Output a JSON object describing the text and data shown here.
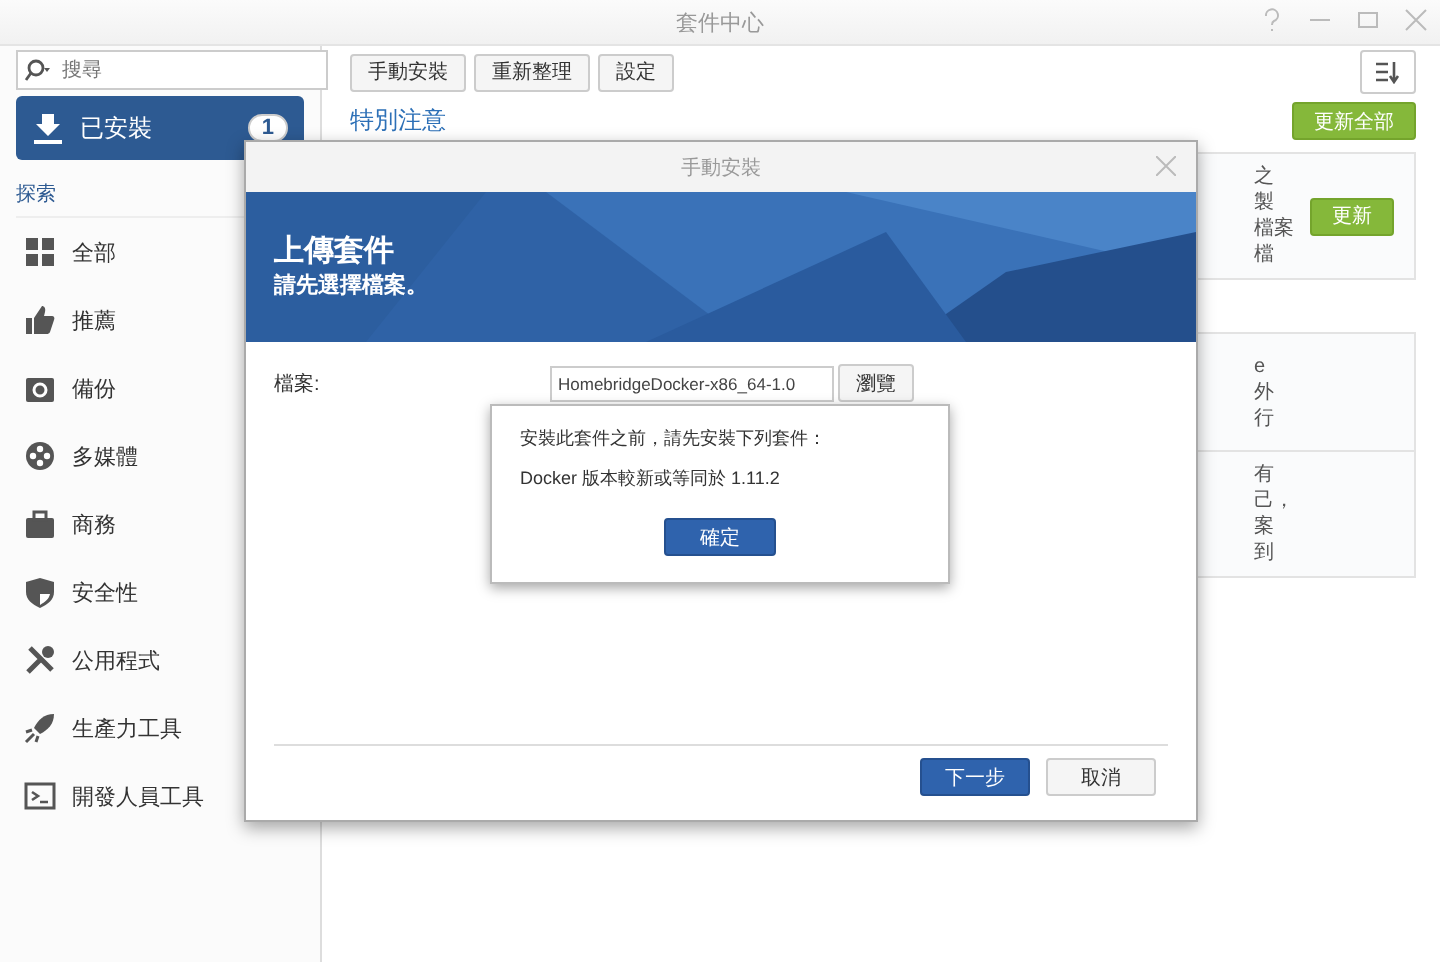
{
  "window": {
    "title": "套件中心"
  },
  "sidebar": {
    "search": {
      "placeholder": "搜尋"
    },
    "installed": {
      "label": "已安裝",
      "badge": "1",
      "selected": true
    },
    "section": "探索",
    "items": [
      {
        "label": "全部",
        "selected": false
      },
      {
        "label": "推薦",
        "selected": false
      },
      {
        "label": "備份",
        "selected": false
      },
      {
        "label": "多媒體",
        "selected": false
      },
      {
        "label": "商務",
        "selected": false
      },
      {
        "label": "安全性",
        "selected": false
      },
      {
        "label": "公用程式",
        "selected": false
      },
      {
        "label": "生產力工具",
        "selected": false
      },
      {
        "label": "開發人員工具",
        "selected": false
      }
    ]
  },
  "toolbar": {
    "buttons": [
      "手動安裝",
      "重新整理",
      "設定"
    ]
  },
  "notice": {
    "heading": "特別注意",
    "update_all": "更新全部",
    "cards": [
      {
        "lines": [
          "之",
          "製",
          "檔案",
          "檔"
        ],
        "button": "更新"
      },
      {
        "lines": [
          "e",
          "外",
          "行"
        ]
      },
      {
        "lines": [
          "有",
          "己，",
          "案",
          "到"
        ]
      }
    ]
  },
  "dialog": {
    "title": "手動安裝",
    "banner_title": "上傳套件",
    "banner_subtitle": "請先選擇檔案。",
    "file_label": "檔案:",
    "file_value": "HomebridgeDocker-x86_64-1.0",
    "browse": "瀏覽",
    "buttons": [
      {
        "label": "下一步",
        "kind": "primary"
      },
      {
        "label": "取消",
        "kind": "secondary"
      }
    ]
  },
  "alert": {
    "message": "安裝此套件之前，請先安裝下列套件：",
    "requirement": "Docker 版本較新或等同於 1.11.2",
    "ok": "確定"
  }
}
